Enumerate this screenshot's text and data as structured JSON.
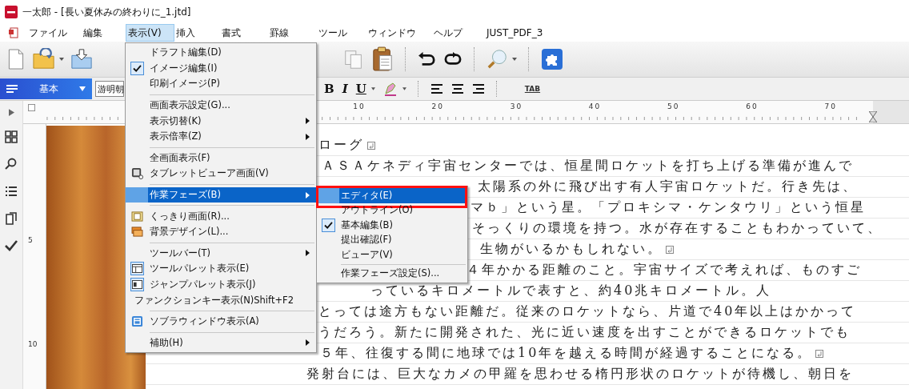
{
  "window": {
    "title": "一太郎 - [長い夏休みの終わりに_1.jtd]"
  },
  "menubar": [
    {
      "label": "ファイル",
      "selected": false
    },
    {
      "label": "編集",
      "selected": false
    },
    {
      "label": "表示(V)",
      "selected": true
    },
    {
      "label": "挿入",
      "selected": false
    },
    {
      "label": "書式",
      "selected": false
    },
    {
      "label": "罫線",
      "selected": false
    },
    {
      "label": "ツール",
      "selected": false
    },
    {
      "label": "ウィンドウ",
      "selected": false
    },
    {
      "label": "ヘルプ",
      "selected": false
    },
    {
      "label": "JUST_PDF_3",
      "selected": false
    }
  ],
  "format_bar": {
    "style": "基本",
    "font": "游明朝",
    "buttons": [
      "B",
      "I",
      "U"
    ],
    "tab": "TAB"
  },
  "ruler": {
    "labels": [
      "10",
      "20",
      "30",
      "40",
      "50",
      "60",
      "70"
    ],
    "side_labels": [
      "5",
      "10"
    ]
  },
  "view_menu": {
    "groups": [
      [
        {
          "label": "ドラフト編集(D)",
          "checked": false,
          "selected": false,
          "submenu": false
        },
        {
          "label": "イメージ編集(I)",
          "checked": true,
          "selected": false,
          "submenu": false
        },
        {
          "label": "印刷イメージ(P)",
          "checked": false,
          "selected": false,
          "submenu": false
        }
      ],
      [
        {
          "label": "画面表示設定(G)...",
          "checked": false,
          "selected": false,
          "submenu": false
        },
        {
          "label": "表示切替(K)",
          "checked": false,
          "selected": false,
          "submenu": true
        },
        {
          "label": "表示倍率(Z)",
          "checked": false,
          "selected": false,
          "submenu": true
        }
      ],
      [
        {
          "label": "全画面表示(F)",
          "checked": false,
          "selected": false,
          "submenu": false
        },
        {
          "label": "タブレットビューア画面(V)",
          "checked": false,
          "selected": false,
          "submenu": false
        }
      ],
      [
        {
          "label": "作業フェーズ(B)",
          "checked": false,
          "selected": true,
          "submenu": true
        }
      ],
      [
        {
          "label": "くっきり画面(R)...",
          "checked": false,
          "selected": false,
          "submenu": false
        },
        {
          "label": "背景デザイン(L)...",
          "checked": false,
          "selected": false,
          "submenu": false
        }
      ],
      [
        {
          "label": "ツールバー(T)",
          "checked": false,
          "selected": false,
          "submenu": true
        },
        {
          "label": "ツールパレット表示(E)",
          "checked": true,
          "selected": false,
          "submenu": false
        },
        {
          "label": "ジャンプパレット表示(J)",
          "checked": true,
          "selected": false,
          "submenu": false
        },
        {
          "label": "ファンクションキー表示(N)",
          "shortcut": "Shift+F2",
          "checked": false,
          "selected": false,
          "submenu": false
        }
      ],
      [
        {
          "label": "ソブラウィンドウ表示(A)",
          "checked": false,
          "selected": false,
          "submenu": false
        }
      ],
      [
        {
          "label": "補助(H)",
          "checked": false,
          "selected": false,
          "submenu": true
        }
      ]
    ]
  },
  "phase_submenu": {
    "groups": [
      [
        {
          "label": "エディタ(E)",
          "checked": false,
          "selected": true,
          "outlined": true
        },
        {
          "label": "アウトライン(O)",
          "checked": false,
          "selected": false,
          "outlined": false
        },
        {
          "label": "基本編集(B)",
          "checked": true,
          "selected": false,
          "outlined": false
        },
        {
          "label": "提出確認(F)",
          "checked": false,
          "selected": false,
          "outlined": false
        },
        {
          "label": "ビューア(V)",
          "checked": false,
          "selected": false,
          "outlined": false
        }
      ],
      [
        {
          "label": "作業フェーズ設定(S)...",
          "checked": false,
          "selected": false,
          "outlined": false
        }
      ]
    ]
  },
  "document": {
    "lines": [
      {
        "text": "ローグ",
        "return_mark": true
      },
      {
        "text": "ＡＳＡケネディ宇宙センターでは、恒星間ロケットを打ち上げる準備が進んで",
        "return_mark": false
      },
      {
        "text": "太陽系の外に飛び出す有人宇宙ロケットだ。行き先は、",
        "return_mark": false
      },
      {
        "text": "マｂ」という星。「プロキシマ・ケンタウリ」という恒星",
        "return_mark": false
      },
      {
        "text": "そっくりの環境を持つ。水が存在することもわかっていて、",
        "return_mark": false
      },
      {
        "text": "生物がいるかもしれない。",
        "return_mark": true
      },
      {
        "text": "４年かかる距離のこと。宇宙サイズで考えれば、ものすご",
        "return_mark": false
      },
      {
        "text": "っているキロメートルで表すと、約40兆キロメートル。人",
        "return_mark": false
      },
      {
        "text": "とっては途方もない距離だ。従来のロケットなら、片道で40年以上はかかって",
        "return_mark": false
      },
      {
        "text": "うだろう。新たに開発された、光に近い速度を出すことができるロケットでも",
        "return_mark": false
      },
      {
        "text": "５年、往復する間に地球では10年を越える時間が経過することになる。",
        "return_mark": true
      },
      {
        "text": "発射台には、巨大なカメの甲羅を思わせる楕円形状のロケットが待機し、朝日を",
        "return_mark": false
      }
    ]
  }
}
